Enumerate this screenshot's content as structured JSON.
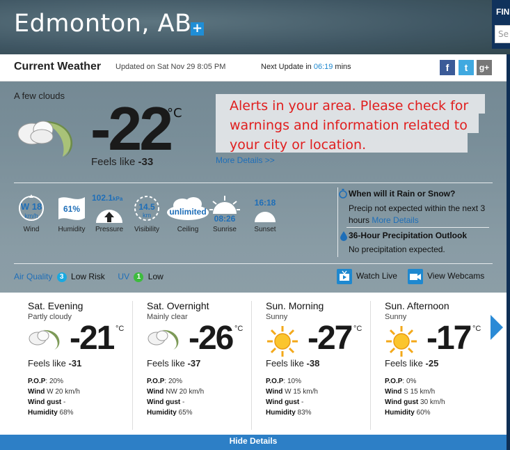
{
  "header": {
    "city": "Edmonton, AB",
    "add_label": "+"
  },
  "find": {
    "label": "FIN",
    "placeholder": "Se"
  },
  "current_bar": {
    "title": "Current Weather",
    "updated": "Updated on Sat Nov 29 8:05 PM",
    "next_update_prefix": "Next Update in",
    "next_update_time": "06:19",
    "next_update_suffix": "mins"
  },
  "social": {
    "facebook": "f",
    "twitter": "t",
    "gplus": "g+"
  },
  "current": {
    "condition": "A few clouds",
    "temp": "-22",
    "unit": "°C",
    "feels_label": "Feels like",
    "feels_value": "-33",
    "alert": "Alerts in your area. Please check for warnings and information related to your city or location.",
    "more_details": "More Details >>"
  },
  "stats": {
    "wind": {
      "dir": "W",
      "speed": "18",
      "unit": "km/h",
      "label": "Wind"
    },
    "humidity": {
      "value": "61%",
      "label": "Humidity"
    },
    "pressure": {
      "value": "102.1",
      "unit": "kPa",
      "label": "Pressure"
    },
    "visibility": {
      "value": "14.5",
      "unit": "km",
      "label": "Visibility"
    },
    "ceiling": {
      "value": "unlimited",
      "label": "Ceiling"
    },
    "sunrise": {
      "value": "08:26",
      "label": "Sunrise"
    },
    "sunset": {
      "value": "16:18",
      "label": "Sunset"
    }
  },
  "rain": {
    "title": "When will it Rain or Snow?",
    "text": "Precip not expected within the next 3 hours",
    "link": "More Details",
    "outlook_title": "36-Hour Precipitation Outlook",
    "outlook_text": "No precipitation expected."
  },
  "bottom_row": {
    "aq_label": "Air Quality",
    "aq_value": "3",
    "aq_text": "Low Risk",
    "uv_label": "UV",
    "uv_value": "1",
    "uv_text": "Low",
    "watch_live": "Watch Live",
    "view_webcams": "View Webcams"
  },
  "forecast": [
    {
      "period": "Sat. Evening",
      "desc": "Partly cloudy",
      "temp": "-21",
      "unit": "°C",
      "feels_label": "Feels like",
      "feels": "-31",
      "pop_label": "P.O.P",
      "pop": ": 20%",
      "wind_label": "Wind",
      "wind": " W 20 km/h",
      "gust_label": "Wind gust",
      "gust": " -",
      "hum_label": "Humidity",
      "hum": " 68%",
      "icon": "night-cloud-icon"
    },
    {
      "period": "Sat. Overnight",
      "desc": "Mainly clear",
      "temp": "-26",
      "unit": "°C",
      "feels_label": "Feels like",
      "feels": "-37",
      "pop_label": "P.O.P",
      "pop": ": 20%",
      "wind_label": "Wind",
      "wind": " NW 20 km/h",
      "gust_label": "Wind gust",
      "gust": " -",
      "hum_label": "Humidity",
      "hum": " 65%",
      "icon": "night-cloud-icon"
    },
    {
      "period": "Sun. Morning",
      "desc": "Sunny",
      "temp": "-27",
      "unit": "°C",
      "feels_label": "Feels like",
      "feels": "-38",
      "pop_label": "P.O.P",
      "pop": ": 10%",
      "wind_label": "Wind",
      "wind": " W 15 km/h",
      "gust_label": "Wind gust",
      "gust": " -",
      "hum_label": "Humidity",
      "hum": " 83%",
      "icon": "sun-icon"
    },
    {
      "period": "Sun. Afternoon",
      "desc": "Sunny",
      "temp": "-17",
      "unit": "°C",
      "feels_label": "Feels like",
      "feels": "-25",
      "pop_label": "P.O.P",
      "pop": ": 0%",
      "wind_label": "Wind",
      "wind": " S 15 km/h",
      "gust_label": "Wind gust",
      "gust": " 30 km/h",
      "hum_label": "Humidity",
      "hum": " 60%",
      "icon": "sun-icon"
    }
  ],
  "hide_details": "Hide Details",
  "colors": {
    "accent": "#1e88cf",
    "alert": "#e01e1e",
    "aq_badge": "#1aa9e0",
    "uv_badge": "#3dbb3d"
  }
}
